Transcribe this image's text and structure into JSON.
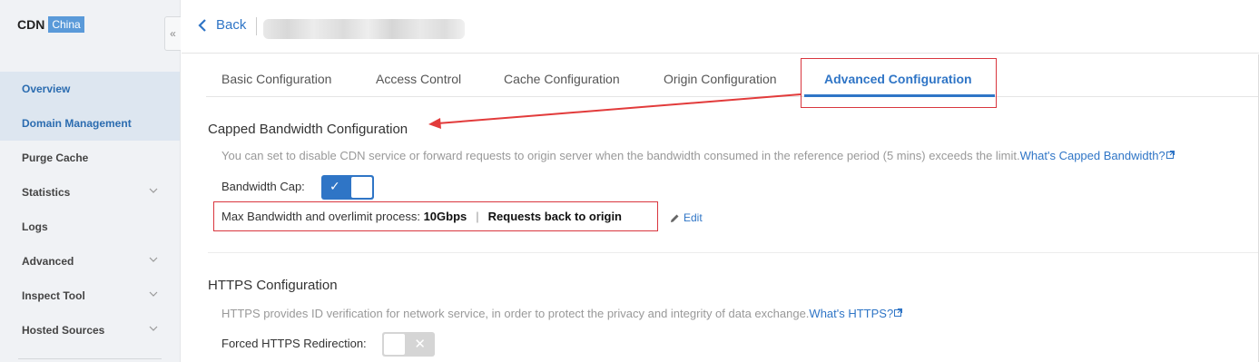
{
  "sidebar": {
    "brand": "CDN",
    "badge": "China",
    "items": [
      {
        "label": "Overview",
        "expandable": false
      },
      {
        "label": "Domain Management",
        "expandable": false
      },
      {
        "label": "Purge Cache",
        "expandable": false
      },
      {
        "label": "Statistics",
        "expandable": true
      },
      {
        "label": "Logs",
        "expandable": false
      },
      {
        "label": "Advanced",
        "expandable": true
      },
      {
        "label": "Inspect Tool",
        "expandable": true
      },
      {
        "label": "Hosted Sources",
        "expandable": true
      }
    ],
    "collapse_icon": "«"
  },
  "header": {
    "back_label": "Back"
  },
  "tabs": [
    {
      "label": "Basic Configuration"
    },
    {
      "label": "Access Control"
    },
    {
      "label": "Cache Configuration"
    },
    {
      "label": "Origin Configuration"
    },
    {
      "label": "Advanced Configuration"
    }
  ],
  "capped": {
    "title": "Capped Bandwidth Configuration",
    "desc": "You can set to disable CDN service or forward requests to origin server when the bandwidth consumed in the reference period (5 mins) exceeds the limit.",
    "desc_link": "What's Capped Bandwidth?",
    "cap_label": "Bandwidth Cap:",
    "cap_enabled": true,
    "max_label": "Max Bandwidth and overlimit process:",
    "max_value": "10Gbps",
    "separator": "|",
    "process": "Requests back to origin",
    "edit_label": "Edit"
  },
  "https": {
    "title": "HTTPS Configuration",
    "desc": "HTTPS provides ID verification for network service, in order to protect the privacy and integrity of data exchange.",
    "desc_link": "What's HTTPS?",
    "redirect_label": "Forced HTTPS Redirection:",
    "redirect_enabled": false
  },
  "colors": {
    "accent": "#2f75c6",
    "highlight": "#d9363e",
    "sidebar_bg": "#f0f2f5"
  }
}
